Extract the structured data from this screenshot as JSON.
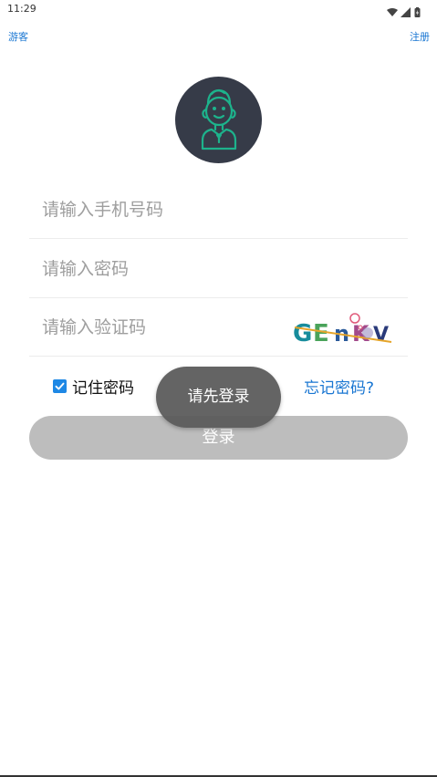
{
  "status_bar": {
    "time": "11:29"
  },
  "header": {
    "guest_label": "游客",
    "register_label": "注册"
  },
  "form": {
    "phone_placeholder": "请输入手机号码",
    "password_placeholder": "请输入密码",
    "captcha_placeholder": "请输入验证码",
    "captcha_text": "GEnKV",
    "remember_label": "记住密码",
    "remember_checked": true,
    "forgot_label": "忘记密码?",
    "login_label": "登录"
  },
  "toast": {
    "message": "请先登录"
  },
  "colors": {
    "accent": "#1976d2",
    "avatar_bg": "#363b48",
    "avatar_line": "#1db38c",
    "button_disabled": "#bdbdbd",
    "toast_bg": "#585858"
  }
}
